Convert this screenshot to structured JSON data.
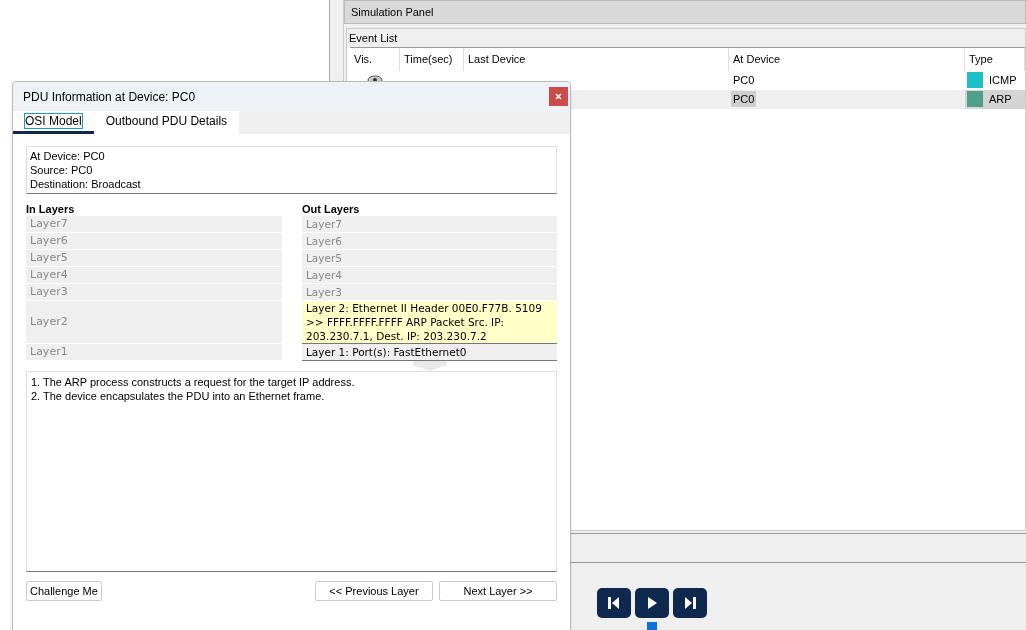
{
  "simulation_panel": {
    "title": "Simulation Panel",
    "event_list": {
      "title": "Event List",
      "columns": [
        "Vis.",
        "Time(sec)",
        "Last Device",
        "At Device",
        "Type"
      ],
      "rows": [
        {
          "visible": true,
          "at_device": "PC0",
          "type": "ICMP",
          "color": "#1bbfc8",
          "selected": false
        },
        {
          "at_device": "PC0",
          "type": "ARP",
          "color": "#4fa08a",
          "selected": true
        }
      ]
    },
    "controls": [
      {
        "kind": "back"
      },
      {
        "kind": "play"
      },
      {
        "kind": "forward"
      }
    ]
  },
  "dialog": {
    "title": "PDU Information at Device: PC0",
    "tabs": [
      {
        "label": "OSI Model",
        "selected": true
      },
      {
        "label": "Outbound PDU Details",
        "selected": false
      }
    ],
    "info": [
      "At Device: PC0",
      "Source: PC0",
      "Destination: Broadcast"
    ],
    "in_layers": {
      "title": "In Layers",
      "items": [
        {
          "label": "Layer7",
          "active": false,
          "tall": false
        },
        {
          "label": "Layer6",
          "active": false,
          "tall": false
        },
        {
          "label": "Layer5",
          "active": false,
          "tall": false
        },
        {
          "label": "Layer4",
          "active": false,
          "tall": false
        },
        {
          "label": "Layer3",
          "active": false,
          "tall": false
        },
        {
          "label": "Layer2",
          "active": false,
          "tall": true
        },
        {
          "label": "Layer1",
          "active": false,
          "tall": false
        }
      ]
    },
    "out_layers": {
      "title": "Out Layers",
      "items": [
        {
          "label": "Layer7",
          "active": false,
          "selected": false
        },
        {
          "label": "Layer6",
          "active": false,
          "selected": false
        },
        {
          "label": "Layer5",
          "active": false,
          "selected": false
        },
        {
          "label": "Layer4",
          "active": false,
          "selected": false
        },
        {
          "label": "Layer3",
          "active": false,
          "selected": false
        },
        {
          "label": "Layer 2: Ethernet II Header 00E0.F77B. 5109 >> FFFF.FFFF.FFFF ARP Packet Src. IP: 203.230.7.1, Dest. IP: 203.230.7.2",
          "active": true,
          "selected": true
        },
        {
          "label": "Layer 1: Port(s): FastEthernet0",
          "active": true,
          "selected": false
        }
      ]
    },
    "description": [
      "1. The ARP process constructs a request for the target IP address.",
      "2. The device encapsulates the PDU into an Ethernet frame."
    ],
    "buttons": {
      "challenge": "Challenge Me",
      "previous": "<< Previous Layer",
      "next": "Next Layer >>"
    }
  }
}
